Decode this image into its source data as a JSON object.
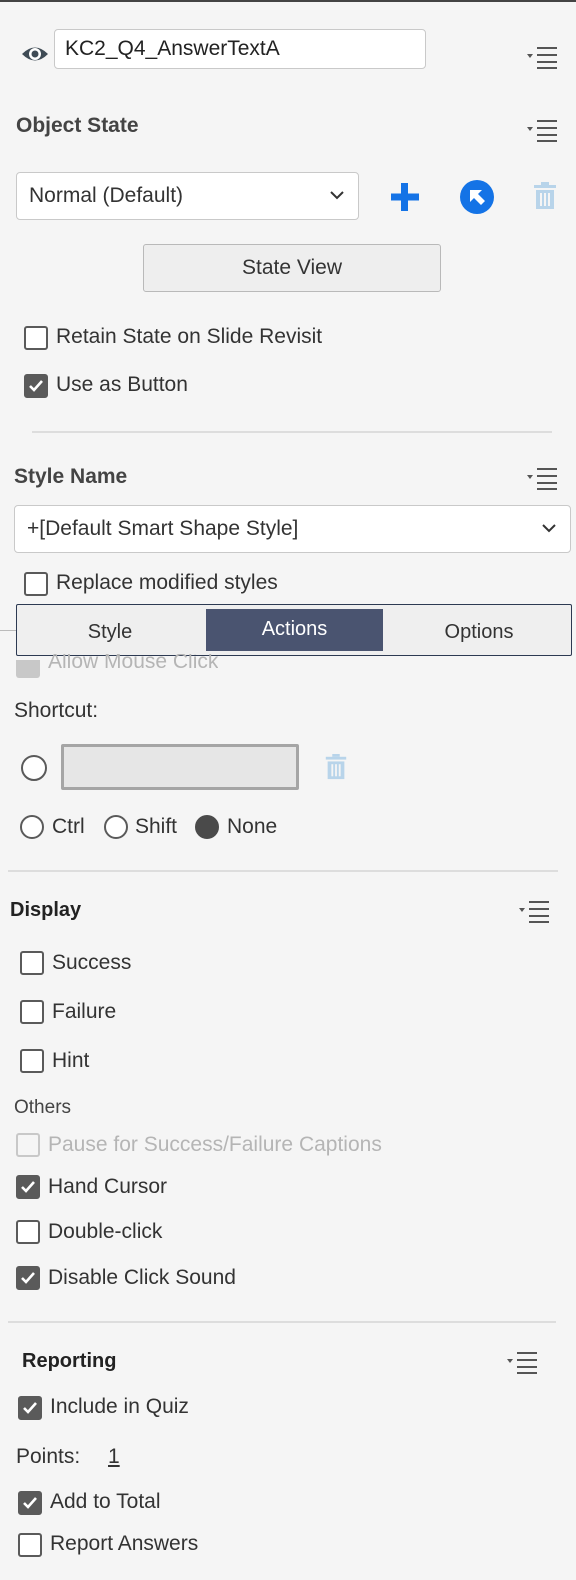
{
  "object": {
    "name": "KC2_Q4_AnswerTextA"
  },
  "object_state": {
    "heading": "Object State",
    "state_select": "Normal (Default)",
    "state_view_button": "State View",
    "retain_state_label": "Retain State on Slide Revisit",
    "retain_state_checked": false,
    "use_as_button_label": "Use as Button",
    "use_as_button_checked": true
  },
  "style": {
    "heading": "Style Name",
    "style_select": "+[Default Smart Shape Style]",
    "replace_label": "Replace modified styles",
    "replace_checked": false
  },
  "tabs": [
    {
      "label": "Style",
      "active": false
    },
    {
      "label": "Actions",
      "active": true
    },
    {
      "label": "Options",
      "active": false
    }
  ],
  "actions": {
    "allow_mouse_click_label": "Allow Mouse Click",
    "shortcut_label": "Shortcut:",
    "modifiers": [
      {
        "label": "Ctrl",
        "selected": false
      },
      {
        "label": "Shift",
        "selected": false
      },
      {
        "label": "None",
        "selected": true
      }
    ]
  },
  "display": {
    "heading": "Display",
    "items": [
      {
        "label": "Success",
        "checked": false
      },
      {
        "label": "Failure",
        "checked": false
      },
      {
        "label": "Hint",
        "checked": false
      }
    ],
    "others_heading": "Others",
    "others": [
      {
        "label": "Pause for Success/Failure Captions",
        "checked": false,
        "disabled": true
      },
      {
        "label": "Hand Cursor",
        "checked": true,
        "disabled": false
      },
      {
        "label": "Double-click",
        "checked": false,
        "disabled": false
      },
      {
        "label": "Disable Click Sound",
        "checked": true,
        "disabled": false
      }
    ]
  },
  "reporting": {
    "heading": "Reporting",
    "include_in_quiz_label": "Include in Quiz",
    "include_in_quiz_checked": true,
    "points_label": "Points:",
    "points_value": "1",
    "add_to_total_label": "Add to Total",
    "add_to_total_checked": true,
    "report_answers_label": "Report Answers",
    "report_answers_checked": false
  },
  "colors": {
    "accent_blue": "#1473e6",
    "active_tab": "#4a5470",
    "panel_bg": "#f5f5f5",
    "disabled_icon": "#b8d4ea"
  }
}
